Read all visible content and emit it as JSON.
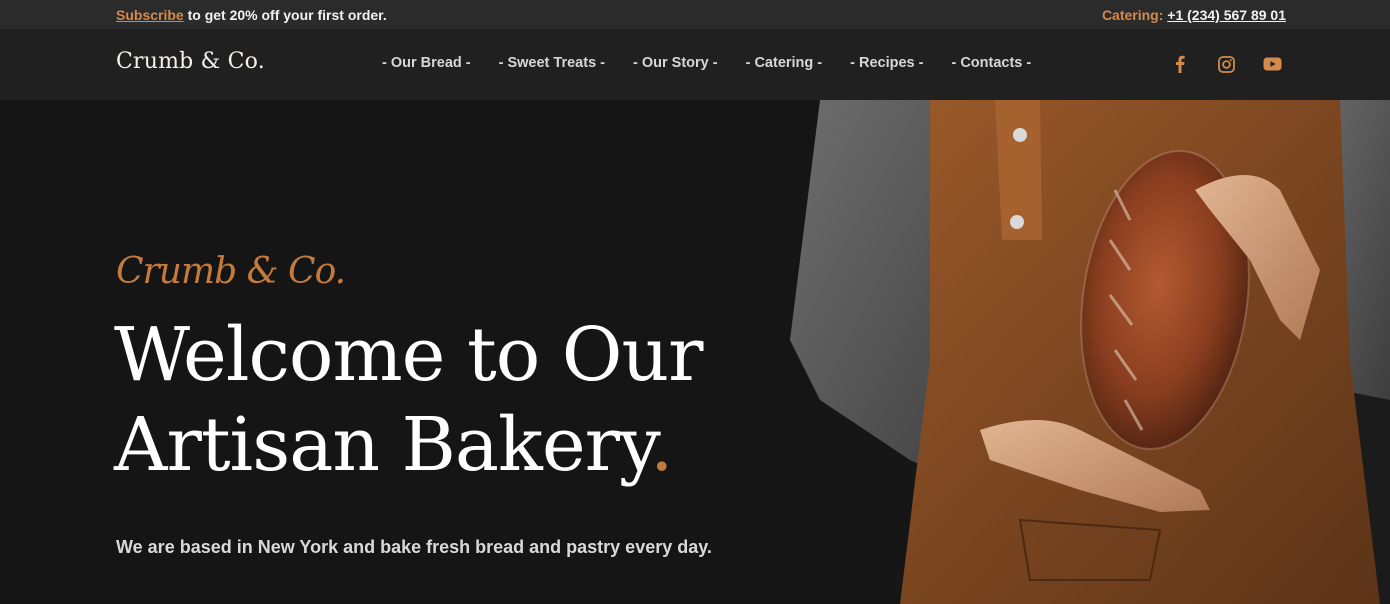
{
  "topbar": {
    "subscribe_label": "Subscribe",
    "promo_text": "to get 20% off your first order.",
    "catering_label": "Catering:",
    "phone": "+1 (234) 567 89 01"
  },
  "header": {
    "logo": "Crumb & Co.",
    "nav": [
      "- Our Bread -",
      "- Sweet Treats -",
      "- Our Story -",
      "- Catering -",
      "- Recipes -",
      "- Contacts -"
    ],
    "social_icons": [
      "facebook-icon",
      "instagram-icon",
      "youtube-icon"
    ]
  },
  "hero": {
    "script_title": "Crumb & Co.",
    "headline_line1": "Welcome to Our",
    "headline_line2": "Artisan Bakery",
    "headline_dot": ".",
    "subtitle": "We are based in New York and bake fresh bread and pastry every day."
  },
  "colors": {
    "accent": "#d48a4b",
    "background": "#141414",
    "topbar": "#2b2b2b",
    "header": "#202020"
  }
}
